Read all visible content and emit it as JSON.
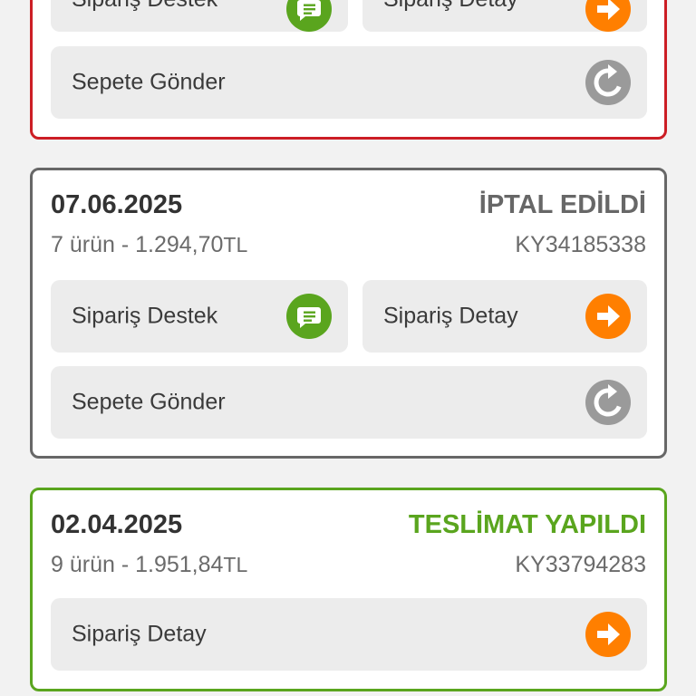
{
  "colors": {
    "chat_green": "#5aa51e",
    "arrow_orange": "#ff7f00",
    "reload_gray": "#9a9a9a",
    "cancelled_gray": "#676767",
    "delivered_green": "#5aa51e",
    "alert_red": "#cc1e25"
  },
  "orders": [
    {
      "buttons": {
        "support_label": "Sipariş Destek",
        "detail_label": "Sipariş Detay",
        "resend_label": "Sepete Gönder"
      }
    },
    {
      "date": "07.06.2025",
      "status": "İPTAL EDİLDİ",
      "item_count": "7 ürün - 1.294,70",
      "currency": "TL",
      "order_no": "KY34185338",
      "buttons": {
        "support_label": "Sipariş Destek",
        "detail_label": "Sipariş Detay",
        "resend_label": "Sepete Gönder"
      }
    },
    {
      "date": "02.04.2025",
      "status": "TESLİMAT YAPILDI",
      "item_count": "9 ürün - 1.951,84",
      "currency": "TL",
      "order_no": "KY33794283",
      "buttons": {
        "detail_label": "Sipariş Detay"
      }
    }
  ],
  "icons": {
    "support": "chat-bubble-icon",
    "detail": "arrow-right-icon",
    "resend": "reload-icon"
  }
}
